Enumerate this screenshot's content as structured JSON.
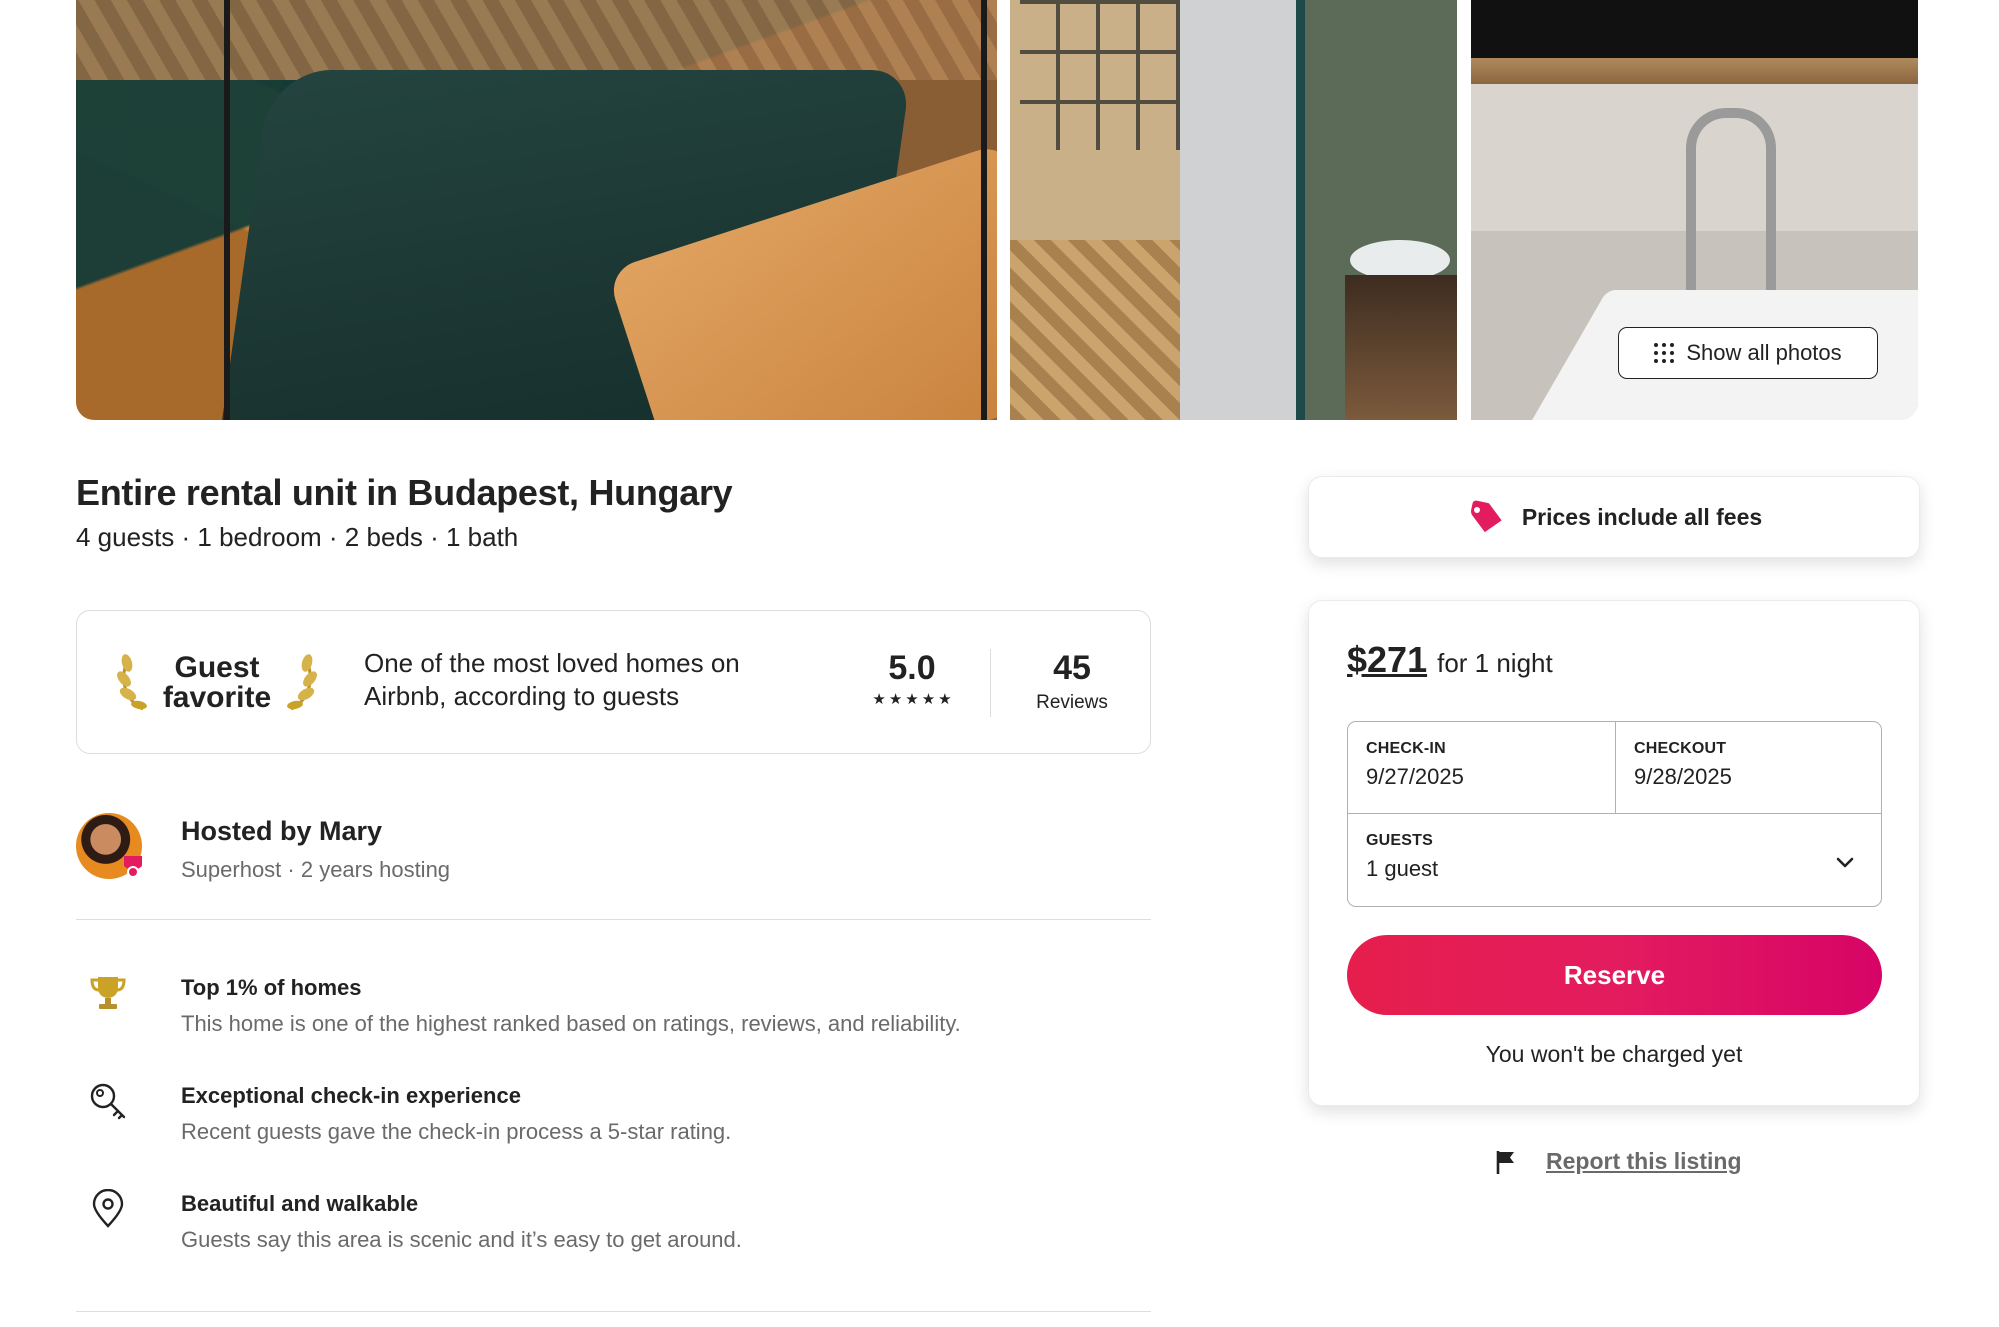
{
  "photos": {
    "show_all_label": "Show all photos",
    "show_all_icon": "grid-dots-icon"
  },
  "listing": {
    "title": "Entire rental unit in Budapest, Hungary",
    "subtitle": "4 guests · 1 bedroom · 2 beds · 1 bath"
  },
  "guest_favorite": {
    "badge_line1": "Guest",
    "badge_line2": "favorite",
    "description": "One of the most loved homes on Airbnb, according to guests",
    "rating": "5.0",
    "stars": 5,
    "reviews_count": "45",
    "reviews_label": "Reviews"
  },
  "host": {
    "name": "Hosted by Mary",
    "meta": "Superhost · 2 years hosting"
  },
  "highlights": [
    {
      "icon": "trophy-icon",
      "title": "Top 1% of homes",
      "description": "This home is one of the highest ranked based on ratings, reviews, and reliability."
    },
    {
      "icon": "key-icon",
      "title": "Exceptional check-in experience",
      "description": "Recent guests gave the check-in process a 5-star rating."
    },
    {
      "icon": "map-pin-icon",
      "title": "Beautiful and walkable",
      "description": "Guests say this area is scenic and it’s easy to get around."
    }
  ],
  "fees_banner": {
    "text": "Prices include all fees",
    "icon": "price-tag-icon"
  },
  "booking": {
    "price": "$271",
    "per": "for 1 night",
    "checkin_label": "CHECK-IN",
    "checkin_value": "9/27/2025",
    "checkout_label": "CHECKOUT",
    "checkout_value": "9/28/2025",
    "guests_label": "GUESTS",
    "guests_value": "1 guest",
    "reserve_label": "Reserve",
    "note": "You won't be charged yet"
  },
  "report": {
    "label": "Report this listing",
    "icon": "flag-icon"
  },
  "colors": {
    "brand": "#e31c5f",
    "text": "#222222",
    "muted": "#6a6a6a",
    "border": "#dddddd",
    "gold": "#c9a227"
  }
}
